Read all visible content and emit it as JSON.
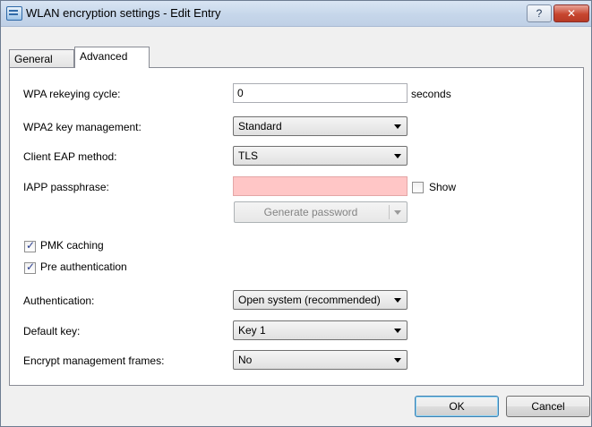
{
  "window": {
    "title": "WLAN encryption settings - Edit Entry",
    "help_label": "?",
    "close_label": "✕"
  },
  "tabs": [
    {
      "label": "General",
      "active": false
    },
    {
      "label": "Advanced",
      "active": true
    }
  ],
  "form": {
    "rekey_label": "WPA rekeying cycle:",
    "rekey_value": "0",
    "rekey_unit": "seconds",
    "wpa2_label": "WPA2 key management:",
    "wpa2_value": "Standard",
    "eap_label": "Client EAP method:",
    "eap_value": "TLS",
    "iapp_label": "IAPP passphrase:",
    "iapp_value": "",
    "show_label": "Show",
    "show_checked": false,
    "generate_label": "Generate password",
    "pmk_label": "PMK caching",
    "pmk_checked": true,
    "preauth_label": "Pre authentication",
    "preauth_checked": true,
    "auth_label": "Authentication:",
    "auth_value": "Open system (recommended)",
    "defkey_label": "Default key:",
    "defkey_value": "Key 1",
    "mgmt_label": "Encrypt management frames:",
    "mgmt_value": "No"
  },
  "buttons": {
    "ok": "OK",
    "cancel": "Cancel"
  },
  "colors": {
    "passphrase_background": "#ffc6c6",
    "default_button_border": "#3c7fb1"
  }
}
